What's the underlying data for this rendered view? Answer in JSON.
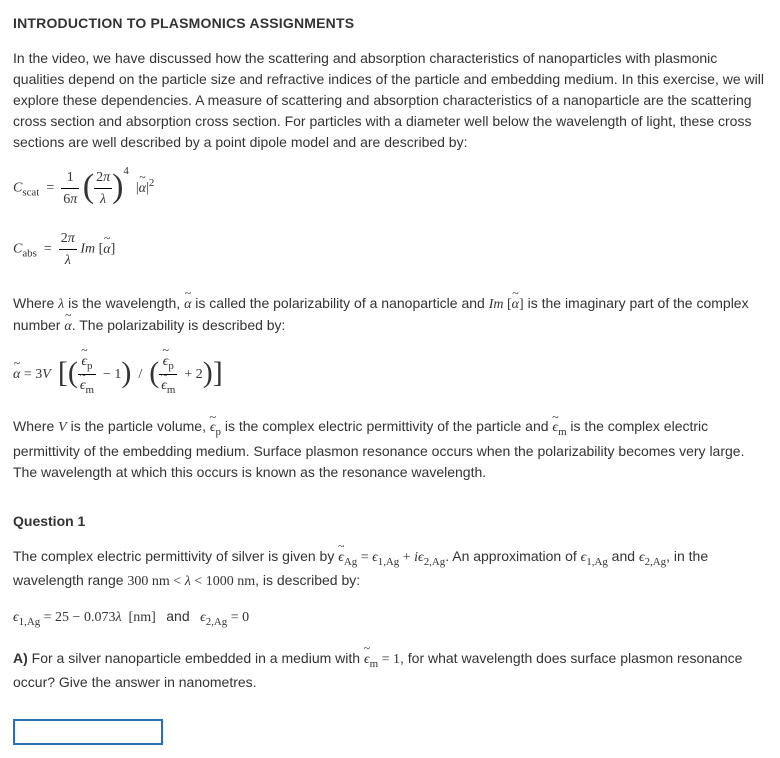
{
  "title": "INTRODUCTION TO PLASMONICS ASSIGNMENTS",
  "intro": "In the video, we have discussed how the scattering and absorption characteristics of nanoparticles with plasmonic qualities depend on the particle size and refractive indices of the particle and embedding medium. In this exercise, we will explore these dependencies. A measure of scattering and absorption characteristics of a nanoparticle are the scattering cross section and absorption cross section. For particles with a diameter well below the wavelength of light, these cross sections are well described by a point dipole model and are described by:",
  "formula_scat_tex": "C_{scat} = (1/6π) · (2π/λ)^4 · |α̃|^2",
  "formula_abs_tex": "C_{abs} = (2π/λ) · Im[α̃]",
  "desc_where1a": "Where ",
  "desc_where1b": " is the wavelength, ",
  "desc_where1c": " is called the polarizability of a nanoparticle and ",
  "desc_where1d": " is the imaginary part of the complex number ",
  "desc_where1e": ". The polarizability is described by:",
  "formula_pol_tex": "α̃ = 3V · [ (ε̃_p / ε̃_m − 1) / (ε̃_p / ε̃_m + 2) ]",
  "desc_where2a": "Where ",
  "desc_where2b": " is the particle volume, ",
  "desc_where2c": " is the complex electric permittivity of the particle and ",
  "desc_where2d": " is the complex electric permittivity of the embedding medium. Surface plasmon resonance occurs when the polarizability becomes very large. The wavelength at which this occurs is known as the resonance wavelength.",
  "q1_heading": "Question 1",
  "q1_text1a": "The complex electric permittivity of silver is given by ",
  "q1_text1b": ". An approximation of ",
  "q1_text1c": " and ",
  "q1_text1d": ", in the wavelength range ",
  "q1_text1e": ", is described by:",
  "q1_range_tex": "300 nm < λ < 1000 nm",
  "q1_eps_tex": "ε̃_Ag = ε_{1,Ag} + i·ε_{2,Ag}",
  "q1_eps1_tex": "ε_{1,Ag} = 25 − 0.073λ [nm]",
  "q1_and": "and",
  "q1_eps2_tex": "ε_{2,Ag} = 0",
  "q1_A_label": "A)",
  "q1_A_text1": " For a silver nanoparticle embedded in a medium with ",
  "q1_A_text2": ", for what wavelength does surface plasmon resonance occur? Give the answer in nanometres.",
  "q1_A_em_tex": "ε̃_m = 1",
  "answer_value": ""
}
